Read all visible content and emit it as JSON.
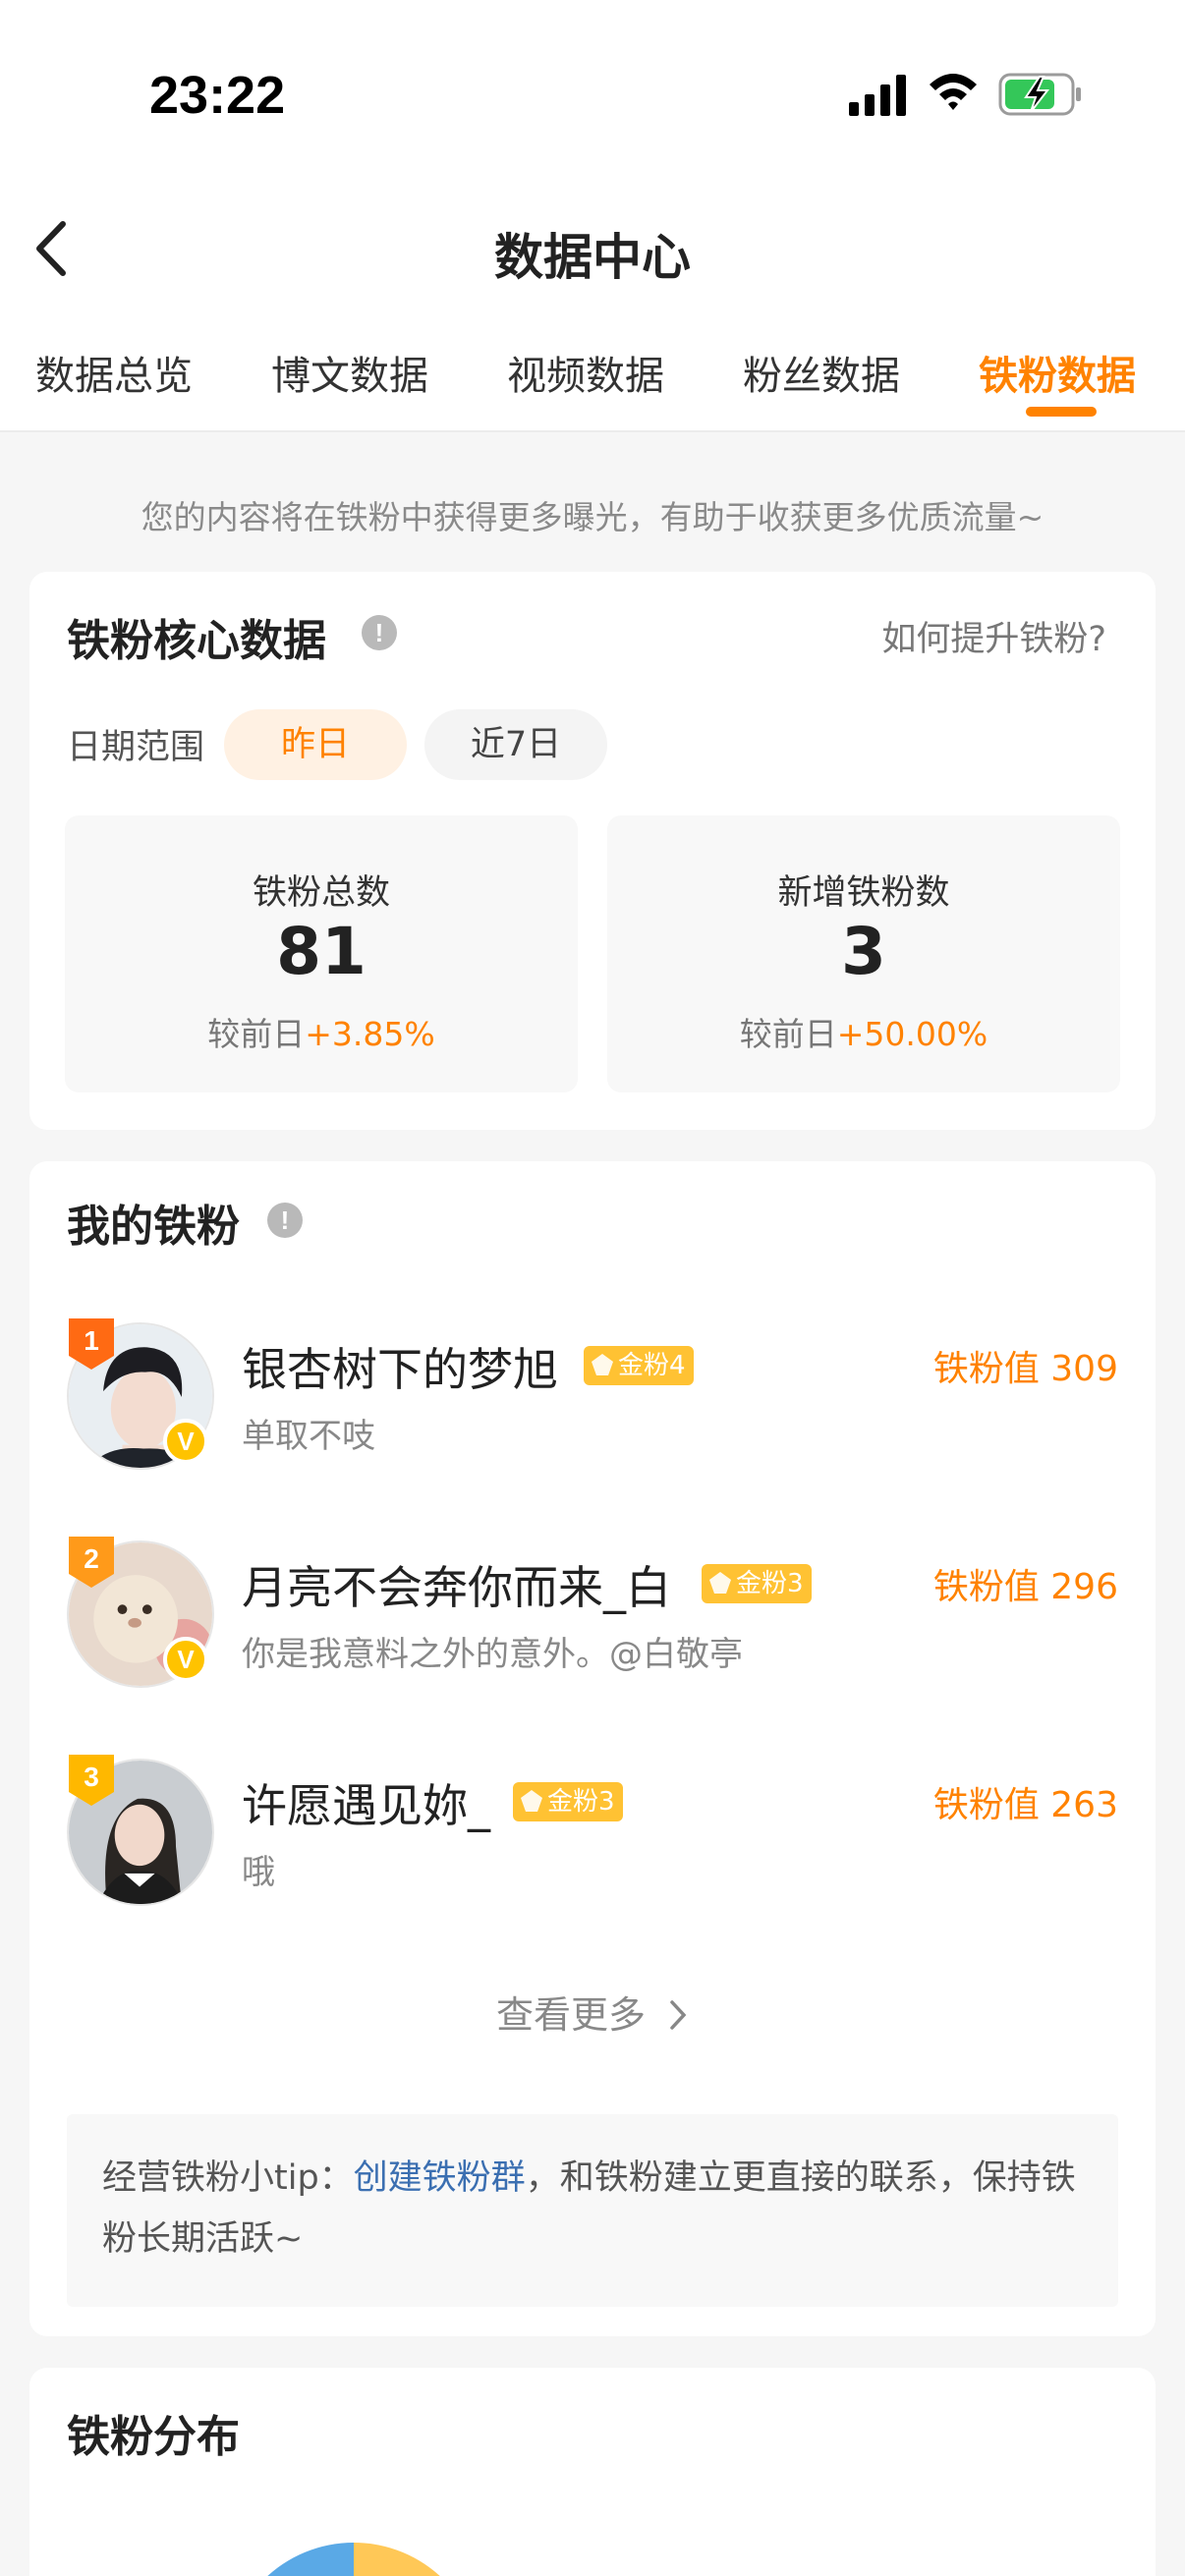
{
  "status": {
    "time": "23:22"
  },
  "header": {
    "title": "数据中心",
    "tabs": [
      "数据总览",
      "博文数据",
      "视频数据",
      "粉丝数据",
      "铁粉数据"
    ],
    "active_tab": "铁粉数据"
  },
  "hint": "您的内容将在铁粉中获得更多曝光，有助于收获更多优质流量~",
  "core": {
    "title": "铁粉核心数据",
    "help_link": "如何提升铁粉?",
    "date_label": "日期范围",
    "ranges": [
      "昨日",
      "近7日"
    ],
    "stats": [
      {
        "label": "铁粉总数",
        "value": "81",
        "compare_prefix": "较前日",
        "compare_value": "+3.85%"
      },
      {
        "label": "新增铁粉数",
        "value": "3",
        "compare_prefix": "较前日",
        "compare_value": "+50.00%"
      }
    ]
  },
  "my_fans": {
    "title": "我的铁粉",
    "items": [
      {
        "rank": "1",
        "name": "银杏树下的梦旭",
        "badge": "金粉4",
        "bio": "单取不吱",
        "score_label": "铁粉值 309"
      },
      {
        "rank": "2",
        "name": "月亮不会奔你而来_白",
        "badge": "金粉3",
        "bio": "你是我意料之外的意外。@白敬亭",
        "score_label": "铁粉值 296"
      },
      {
        "rank": "3",
        "name": "许愿遇见妳_",
        "badge": "金粉3",
        "bio": "哦",
        "score_label": "铁粉值 263"
      }
    ],
    "see_more": "查看更多",
    "tip_prefix": "经营铁粉小tip：",
    "tip_link": "创建铁粉群",
    "tip_suffix": "，和铁粉建立更直接的联系，保持铁粉长期活跃~"
  },
  "distribution": {
    "title": "铁粉分布"
  },
  "colors": {
    "accent": "#ff8200",
    "link": "#3b6fb1",
    "gold": "#ffc233"
  }
}
